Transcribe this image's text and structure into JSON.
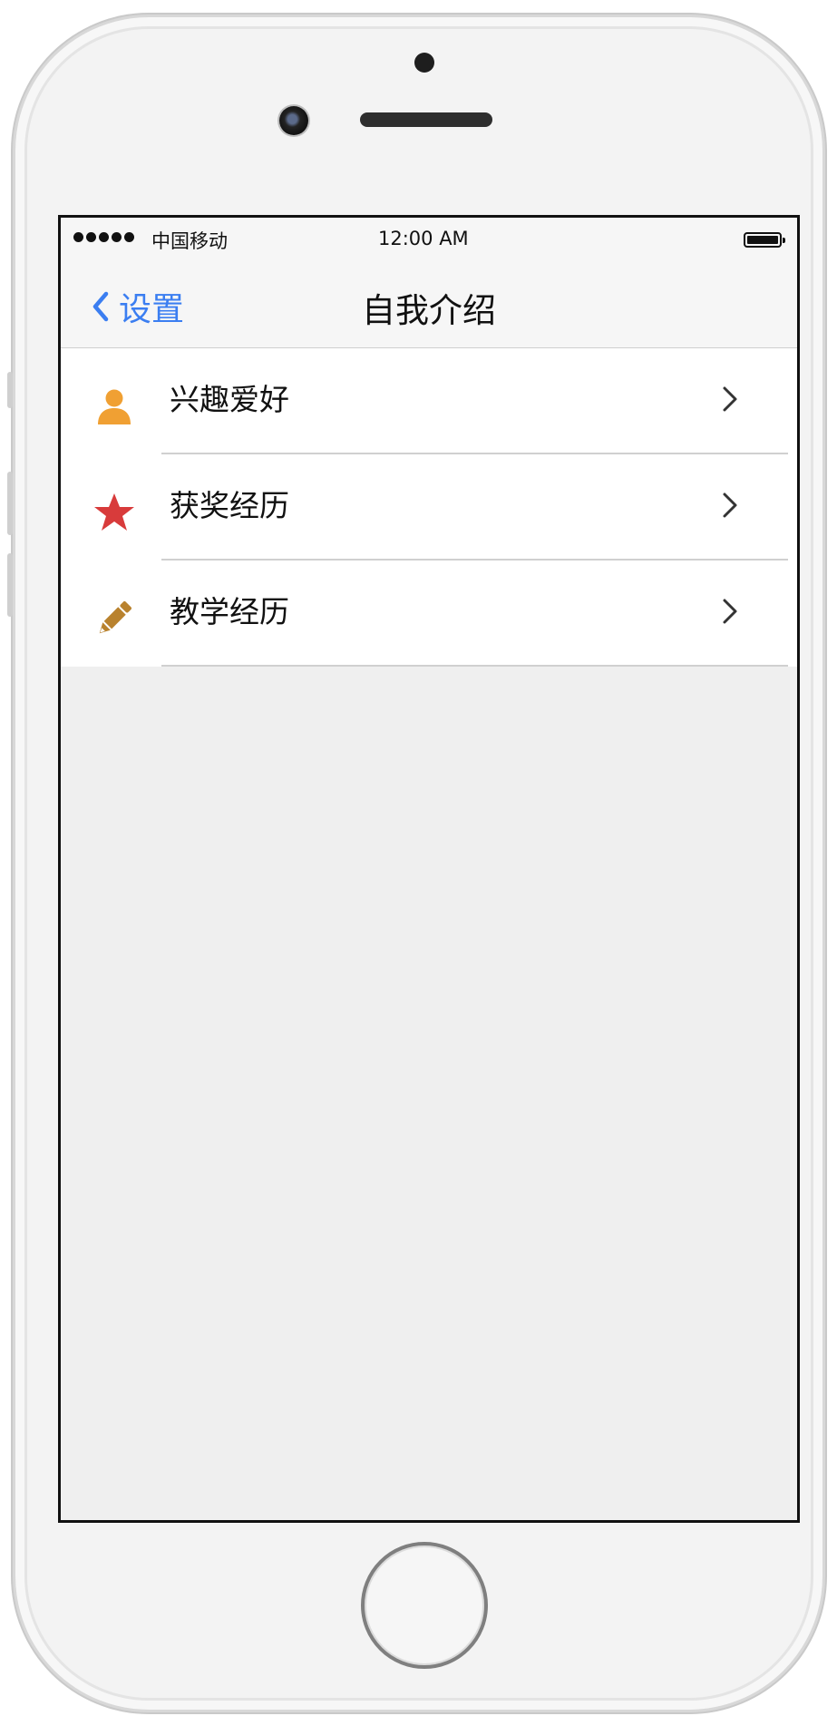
{
  "status_bar": {
    "carrier": "中国移动",
    "time": "12:00 AM"
  },
  "nav": {
    "back_label": "设置",
    "title": "自我介绍"
  },
  "list": {
    "items": [
      {
        "label": "兴趣爱好",
        "icon": "user-icon",
        "icon_color": "#f0a033"
      },
      {
        "label": "获奖经历",
        "icon": "star-icon",
        "icon_color": "#d83b3b"
      },
      {
        "label": "教学经历",
        "icon": "pencil-icon",
        "icon_color": "#b9822e"
      }
    ]
  },
  "colors": {
    "accent": "#3b7ef1",
    "screen_background": "#efefef"
  }
}
